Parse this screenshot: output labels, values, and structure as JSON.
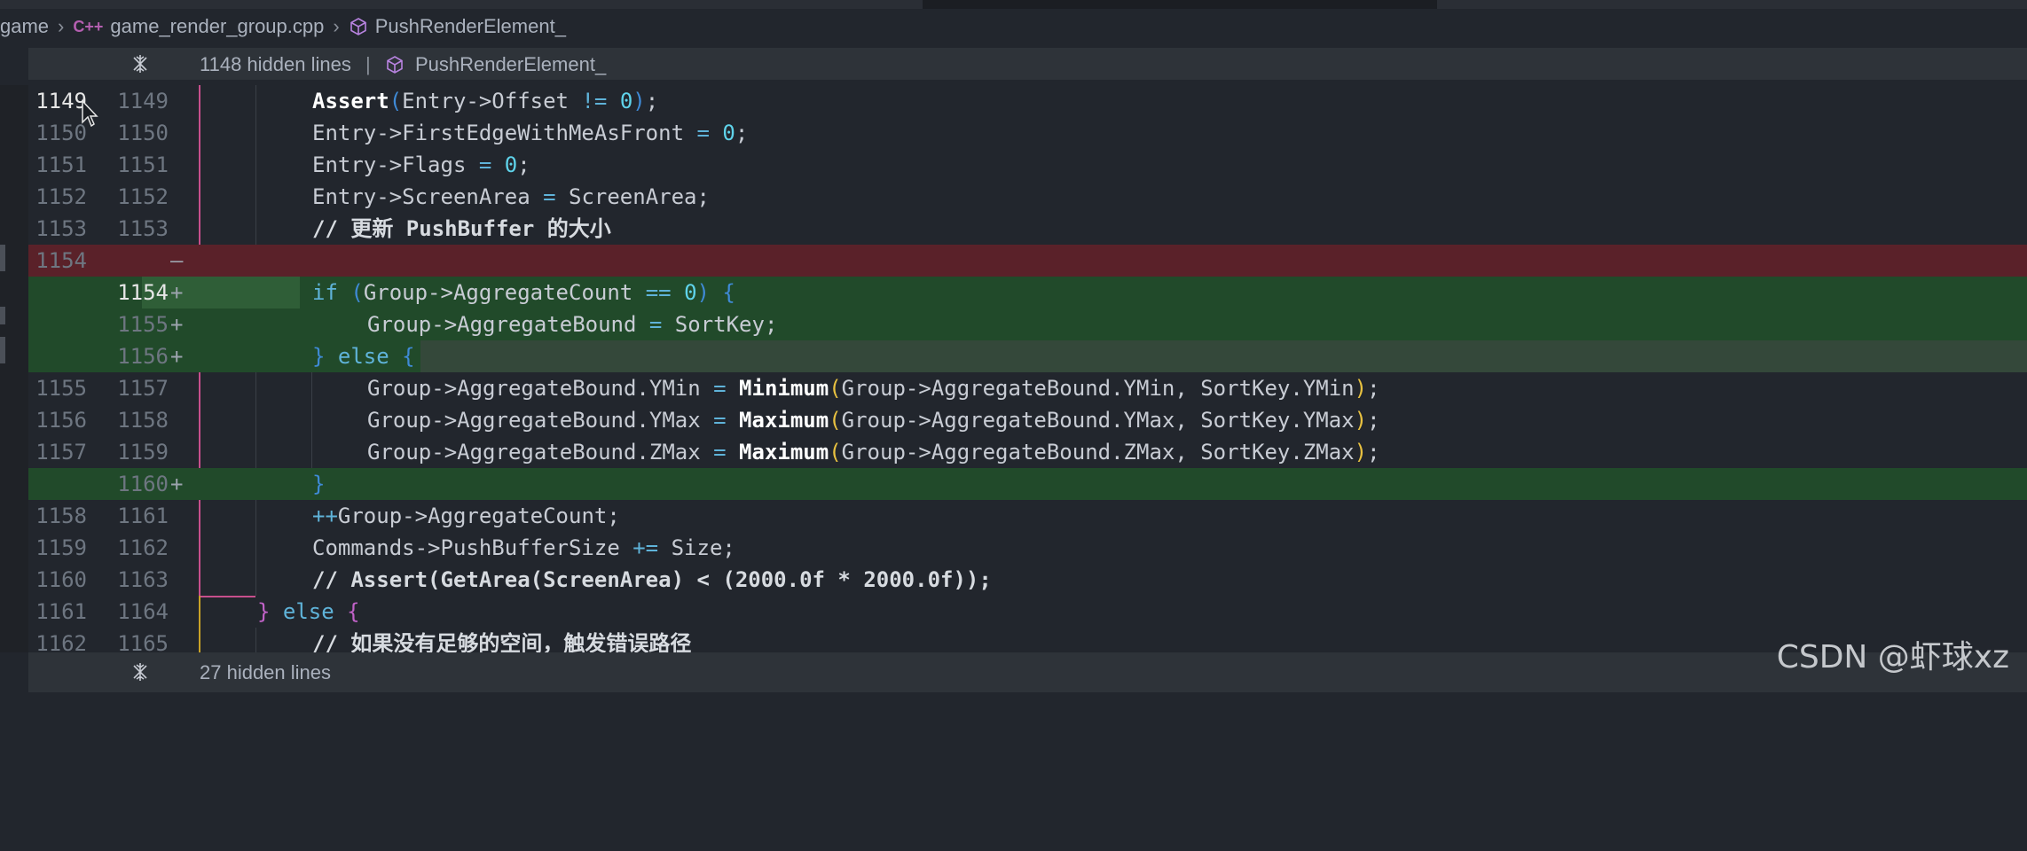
{
  "breadcrumb": {
    "root": "game",
    "file_icon": "C++",
    "file": "game_render_group.cpp",
    "symbol": "PushRenderElement_"
  },
  "hidden_top": {
    "label": "1148 hidden lines",
    "symbol": "PushRenderElement_"
  },
  "hidden_bottom": {
    "label": "27 hidden lines"
  },
  "lines": [
    {
      "old": "1149",
      "new": "1149",
      "kind": "ctx",
      "active": true
    },
    {
      "old": "1150",
      "new": "1150",
      "kind": "ctx"
    },
    {
      "old": "1151",
      "new": "1151",
      "kind": "ctx"
    },
    {
      "old": "1152",
      "new": "1152",
      "kind": "ctx"
    },
    {
      "old": "1153",
      "new": "1153",
      "kind": "ctx"
    },
    {
      "old": "1154",
      "new": "",
      "kind": "removed",
      "marker": "—"
    },
    {
      "old": "",
      "new": "1154",
      "kind": "added",
      "marker": "+"
    },
    {
      "old": "",
      "new": "1155",
      "kind": "added",
      "marker": "+"
    },
    {
      "old": "",
      "new": "1156",
      "kind": "added",
      "marker": "+"
    },
    {
      "old": "1155",
      "new": "1157",
      "kind": "ctx"
    },
    {
      "old": "1156",
      "new": "1158",
      "kind": "ctx"
    },
    {
      "old": "1157",
      "new": "1159",
      "kind": "ctx"
    },
    {
      "old": "",
      "new": "1160",
      "kind": "added",
      "marker": "+"
    },
    {
      "old": "1158",
      "new": "1161",
      "kind": "ctx"
    },
    {
      "old": "1159",
      "new": "1162",
      "kind": "ctx"
    },
    {
      "old": "1160",
      "new": "1163",
      "kind": "ctx"
    },
    {
      "old": "1161",
      "new": "1164",
      "kind": "ctx"
    },
    {
      "old": "1162",
      "new": "1165",
      "kind": "ctx"
    }
  ],
  "code": {
    "l0": [
      "Assert",
      "(",
      "Entry->Offset ",
      "!=",
      " ",
      "0",
      ")",
      ";"
    ],
    "l1": [
      "Entry->FirstEdgeWithMeAsFront ",
      "=",
      " ",
      "0",
      ";"
    ],
    "l2": [
      "Entry->Flags ",
      "=",
      " ",
      "0",
      ";"
    ],
    "l3": [
      "Entry->ScreenArea ",
      "=",
      " ScreenArea;"
    ],
    "l4": "// 更新 PushBuffer 的大小",
    "l6": [
      "if",
      " ",
      "(",
      "Group->AggregateCount ",
      "==",
      " ",
      "0",
      ")",
      " ",
      "{"
    ],
    "l7": [
      "Group->AggregateBound ",
      "=",
      " SortKey;"
    ],
    "l8": [
      "}",
      " ",
      "else",
      " ",
      "{"
    ],
    "l9": [
      "Group->AggregateBound.YMin ",
      "=",
      " ",
      "Minimum",
      "(",
      "Group->AggregateBound.YMin, SortKey.YMin",
      ")",
      ";"
    ],
    "l10": [
      "Group->AggregateBound.YMax ",
      "=",
      " ",
      "Maximum",
      "(",
      "Group->AggregateBound.YMax, SortKey.YMax",
      ")",
      ";"
    ],
    "l11": [
      "Group->AggregateBound.ZMax ",
      "=",
      " ",
      "Maximum",
      "(",
      "Group->AggregateBound.ZMax, SortKey.ZMax",
      ")",
      ";"
    ],
    "l12": [
      "}"
    ],
    "l13": [
      "++",
      "Group->AggregateCount;"
    ],
    "l14": [
      "Commands->PushBufferSize ",
      "+=",
      " Size;"
    ],
    "l15": "// Assert(GetArea(ScreenArea) < (2000.0f * 2000.0f));",
    "l16": [
      "}",
      " ",
      "else",
      " ",
      "{"
    ],
    "l17": "// 如果没有足够的空间，触发错误路径"
  },
  "watermark": "CSDN @虾球xz",
  "colors": {
    "background": "#22262d",
    "removed": "#5a2129",
    "added": "#214a2a",
    "keyword": "#5fb3d9",
    "number": "#5fd3ea"
  }
}
